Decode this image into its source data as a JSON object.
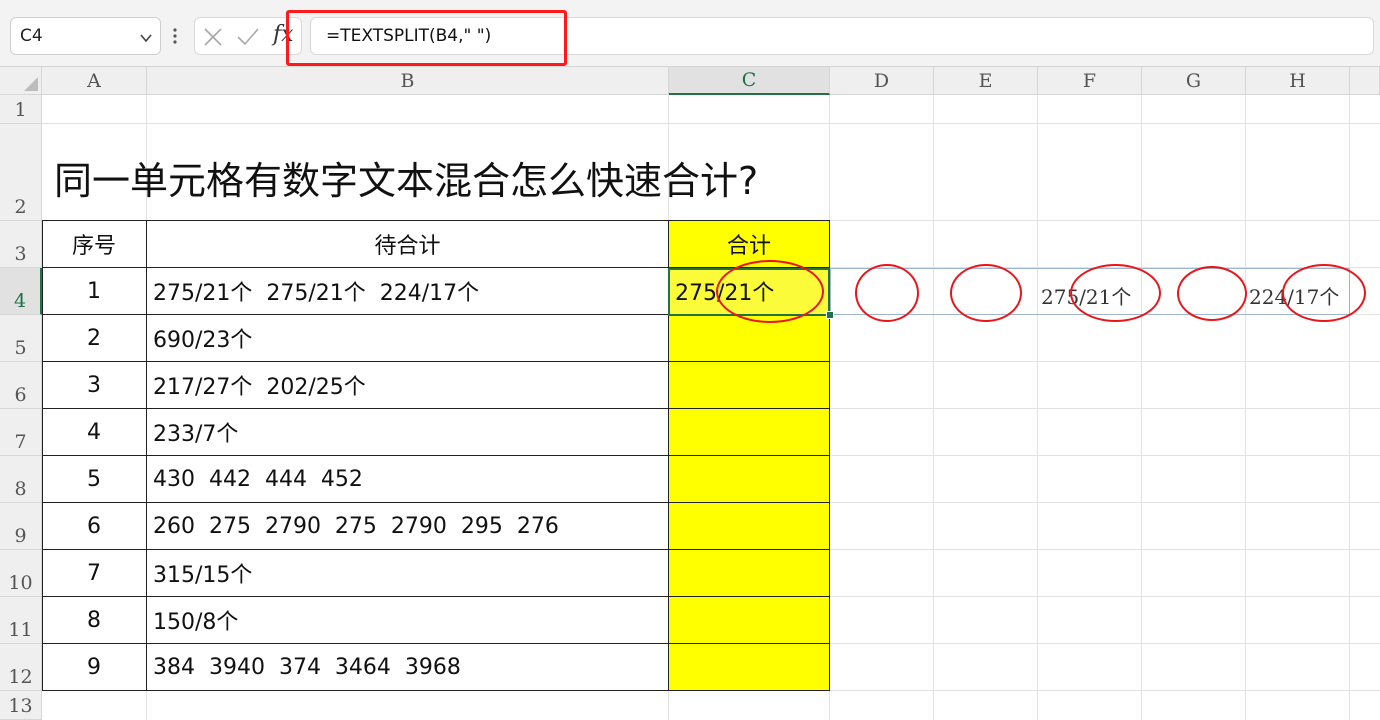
{
  "formula_bar": {
    "name_box": "C4",
    "fx_label": "fx",
    "formula": "=TEXTSPLIT(B4,\" \")"
  },
  "columns": [
    "A",
    "B",
    "C",
    "D",
    "E",
    "F",
    "G",
    "H"
  ],
  "rows": [
    "1",
    "2",
    "3",
    "4",
    "5",
    "6",
    "7",
    "8",
    "9",
    "10",
    "11",
    "12",
    "13"
  ],
  "sheet": {
    "title": "同一单元格有数字文本混合怎么快速合计?",
    "headers": {
      "a": "序号",
      "b": "待合计",
      "c": "合计"
    },
    "table": [
      {
        "no": "1",
        "text": "275/21个  275/21个  224/17个"
      },
      {
        "no": "2",
        "text": "690/23个"
      },
      {
        "no": "3",
        "text": "217/27个  202/25个"
      },
      {
        "no": "4",
        "text": "233/7个"
      },
      {
        "no": "5",
        "text": "430  442  444  452"
      },
      {
        "no": "6",
        "text": "260  275  2790  275  2790  295  276"
      },
      {
        "no": "7",
        "text": "315/15个"
      },
      {
        "no": "8",
        "text": "150/8个"
      },
      {
        "no": "9",
        "text": "384  3940  374  3464  3968"
      }
    ],
    "spill": {
      "c4": "275/21个",
      "f4": "275/21个",
      "h4": "224/17个"
    }
  },
  "colors": {
    "accent": "#217346",
    "highlight": "#ff1a1a",
    "fill": "#ffff00"
  }
}
